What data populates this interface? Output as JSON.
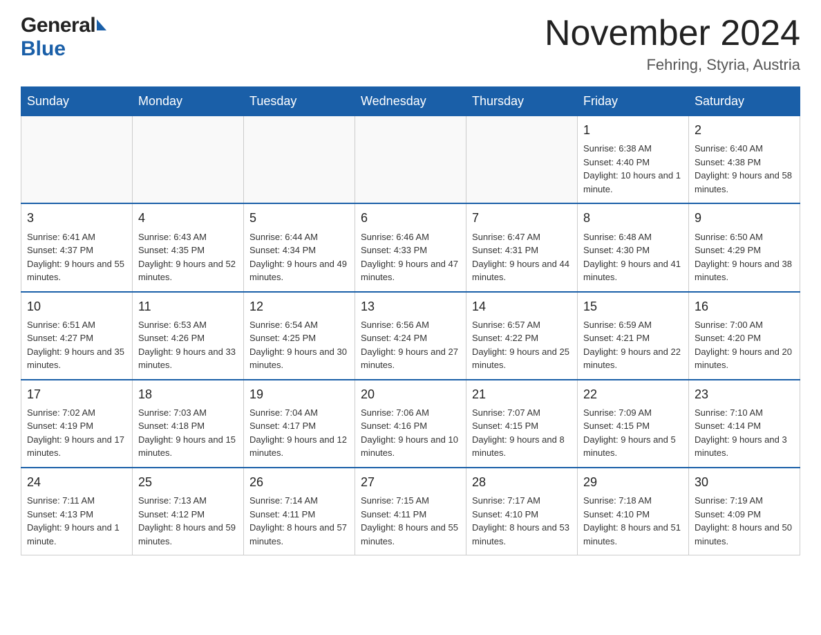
{
  "header": {
    "logo_general": "General",
    "logo_blue": "Blue",
    "month_title": "November 2024",
    "location": "Fehring, Styria, Austria"
  },
  "calendar": {
    "days_of_week": [
      "Sunday",
      "Monday",
      "Tuesday",
      "Wednesday",
      "Thursday",
      "Friday",
      "Saturday"
    ],
    "weeks": [
      [
        {
          "day": "",
          "info": ""
        },
        {
          "day": "",
          "info": ""
        },
        {
          "day": "",
          "info": ""
        },
        {
          "day": "",
          "info": ""
        },
        {
          "day": "",
          "info": ""
        },
        {
          "day": "1",
          "info": "Sunrise: 6:38 AM\nSunset: 4:40 PM\nDaylight: 10 hours and 1 minute."
        },
        {
          "day": "2",
          "info": "Sunrise: 6:40 AM\nSunset: 4:38 PM\nDaylight: 9 hours and 58 minutes."
        }
      ],
      [
        {
          "day": "3",
          "info": "Sunrise: 6:41 AM\nSunset: 4:37 PM\nDaylight: 9 hours and 55 minutes."
        },
        {
          "day": "4",
          "info": "Sunrise: 6:43 AM\nSunset: 4:35 PM\nDaylight: 9 hours and 52 minutes."
        },
        {
          "day": "5",
          "info": "Sunrise: 6:44 AM\nSunset: 4:34 PM\nDaylight: 9 hours and 49 minutes."
        },
        {
          "day": "6",
          "info": "Sunrise: 6:46 AM\nSunset: 4:33 PM\nDaylight: 9 hours and 47 minutes."
        },
        {
          "day": "7",
          "info": "Sunrise: 6:47 AM\nSunset: 4:31 PM\nDaylight: 9 hours and 44 minutes."
        },
        {
          "day": "8",
          "info": "Sunrise: 6:48 AM\nSunset: 4:30 PM\nDaylight: 9 hours and 41 minutes."
        },
        {
          "day": "9",
          "info": "Sunrise: 6:50 AM\nSunset: 4:29 PM\nDaylight: 9 hours and 38 minutes."
        }
      ],
      [
        {
          "day": "10",
          "info": "Sunrise: 6:51 AM\nSunset: 4:27 PM\nDaylight: 9 hours and 35 minutes."
        },
        {
          "day": "11",
          "info": "Sunrise: 6:53 AM\nSunset: 4:26 PM\nDaylight: 9 hours and 33 minutes."
        },
        {
          "day": "12",
          "info": "Sunrise: 6:54 AM\nSunset: 4:25 PM\nDaylight: 9 hours and 30 minutes."
        },
        {
          "day": "13",
          "info": "Sunrise: 6:56 AM\nSunset: 4:24 PM\nDaylight: 9 hours and 27 minutes."
        },
        {
          "day": "14",
          "info": "Sunrise: 6:57 AM\nSunset: 4:22 PM\nDaylight: 9 hours and 25 minutes."
        },
        {
          "day": "15",
          "info": "Sunrise: 6:59 AM\nSunset: 4:21 PM\nDaylight: 9 hours and 22 minutes."
        },
        {
          "day": "16",
          "info": "Sunrise: 7:00 AM\nSunset: 4:20 PM\nDaylight: 9 hours and 20 minutes."
        }
      ],
      [
        {
          "day": "17",
          "info": "Sunrise: 7:02 AM\nSunset: 4:19 PM\nDaylight: 9 hours and 17 minutes."
        },
        {
          "day": "18",
          "info": "Sunrise: 7:03 AM\nSunset: 4:18 PM\nDaylight: 9 hours and 15 minutes."
        },
        {
          "day": "19",
          "info": "Sunrise: 7:04 AM\nSunset: 4:17 PM\nDaylight: 9 hours and 12 minutes."
        },
        {
          "day": "20",
          "info": "Sunrise: 7:06 AM\nSunset: 4:16 PM\nDaylight: 9 hours and 10 minutes."
        },
        {
          "day": "21",
          "info": "Sunrise: 7:07 AM\nSunset: 4:15 PM\nDaylight: 9 hours and 8 minutes."
        },
        {
          "day": "22",
          "info": "Sunrise: 7:09 AM\nSunset: 4:15 PM\nDaylight: 9 hours and 5 minutes."
        },
        {
          "day": "23",
          "info": "Sunrise: 7:10 AM\nSunset: 4:14 PM\nDaylight: 9 hours and 3 minutes."
        }
      ],
      [
        {
          "day": "24",
          "info": "Sunrise: 7:11 AM\nSunset: 4:13 PM\nDaylight: 9 hours and 1 minute."
        },
        {
          "day": "25",
          "info": "Sunrise: 7:13 AM\nSunset: 4:12 PM\nDaylight: 8 hours and 59 minutes."
        },
        {
          "day": "26",
          "info": "Sunrise: 7:14 AM\nSunset: 4:11 PM\nDaylight: 8 hours and 57 minutes."
        },
        {
          "day": "27",
          "info": "Sunrise: 7:15 AM\nSunset: 4:11 PM\nDaylight: 8 hours and 55 minutes."
        },
        {
          "day": "28",
          "info": "Sunrise: 7:17 AM\nSunset: 4:10 PM\nDaylight: 8 hours and 53 minutes."
        },
        {
          "day": "29",
          "info": "Sunrise: 7:18 AM\nSunset: 4:10 PM\nDaylight: 8 hours and 51 minutes."
        },
        {
          "day": "30",
          "info": "Sunrise: 7:19 AM\nSunset: 4:09 PM\nDaylight: 8 hours and 50 minutes."
        }
      ]
    ]
  }
}
